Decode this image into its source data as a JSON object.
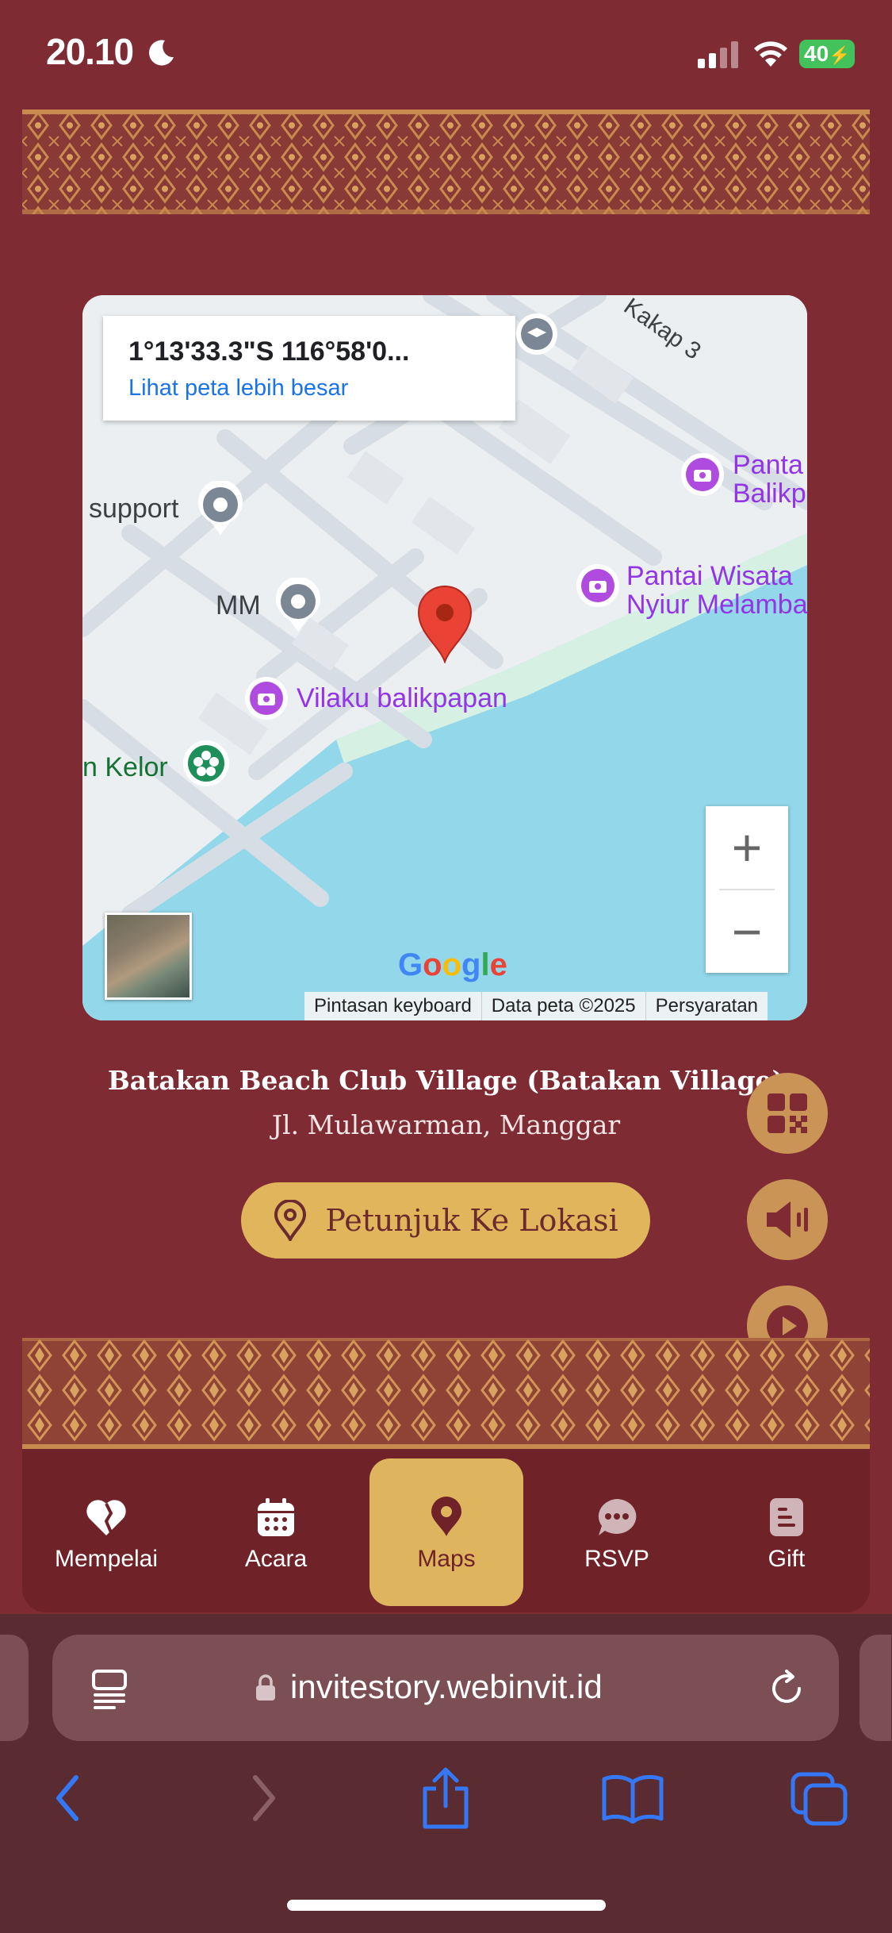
{
  "status_bar": {
    "time": "20.10",
    "battery": "40"
  },
  "map": {
    "coordinates": "1°13'33.3\"S 116°58'0...",
    "larger_map_link": "Lihat peta lebih besar",
    "labels": {
      "road": "Kakap 3",
      "pantai1_line1": "Panta",
      "pantai1_line2": "Balikp",
      "support": "support",
      "mm": "MM",
      "pantai2_line1": "Pantai Wisata",
      "pantai2_line2": "Nyiur Melamba",
      "vilaku": "Vilaku balikpapan",
      "kelor": "n Kelor"
    },
    "zoom_in": "+",
    "zoom_out": "−",
    "google_logo": "Google",
    "attribution": {
      "keyboard": "Pintasan keyboard",
      "data": "Data peta ©2025",
      "terms": "Persyaratan"
    }
  },
  "venue": {
    "name": "Batakan Beach Club Village (Batakan Village)",
    "address": "Jl. Mulawarman, Manggar",
    "directions_label": "Petunjuk Ke Lokasi"
  },
  "nav": {
    "items": [
      {
        "label": "Mempelai",
        "icon": "heart-icon"
      },
      {
        "label": "Acara",
        "icon": "calendar-icon"
      },
      {
        "label": "Maps",
        "icon": "map-pin-icon",
        "active": true
      },
      {
        "label": "RSVP",
        "icon": "chat-bubble-icon"
      },
      {
        "label": "Gift",
        "icon": "document-icon"
      }
    ]
  },
  "browser": {
    "url": "invitestory.webinvit.id"
  },
  "colors": {
    "background": "#7f2b33",
    "accent": "#deb45e",
    "fab": "#c99455",
    "chrome": "#5a2b30"
  }
}
